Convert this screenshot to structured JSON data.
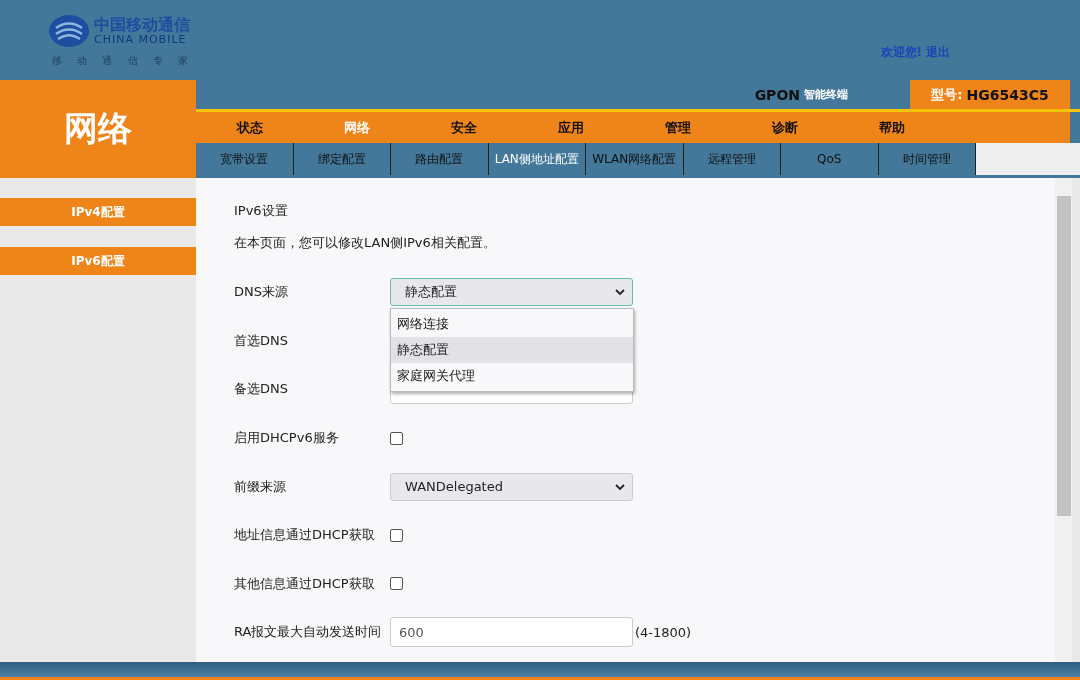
{
  "header": {
    "logo": {
      "cn": "中国移动通信",
      "en": "CHINA MOBILE",
      "slogan": "移 动 通 信 专 家"
    },
    "welcome": "欢迎您!",
    "logout": "退出"
  },
  "section_title": "网络",
  "product": {
    "type": "GPON",
    "type_suffix": "智能终端",
    "model_label": "型号:",
    "model": "HG6543C5"
  },
  "main_menu": [
    {
      "label": "状态",
      "selected": false
    },
    {
      "label": "网络",
      "selected": true
    },
    {
      "label": "安全",
      "selected": false
    },
    {
      "label": "应用",
      "selected": false
    },
    {
      "label": "管理",
      "selected": false
    },
    {
      "label": "诊断",
      "selected": false
    },
    {
      "label": "帮助",
      "selected": false
    }
  ],
  "sub_menu": [
    {
      "label": "宽带设置",
      "selected": false
    },
    {
      "label": "绑定配置",
      "selected": false
    },
    {
      "label": "路由配置",
      "selected": false
    },
    {
      "label": "LAN侧地址配置",
      "selected": true
    },
    {
      "label": "WLAN网络配置",
      "selected": false
    },
    {
      "label": "远程管理",
      "selected": false
    },
    {
      "label": "QoS",
      "selected": false
    },
    {
      "label": "时间管理",
      "selected": false
    }
  ],
  "sidebar": {
    "items": [
      {
        "label": "IPv4配置"
      },
      {
        "label": "IPv6配置"
      }
    ]
  },
  "content": {
    "title": "IPv6设置",
    "description": "在本页面，您可以修改LAN侧IPv6相关配置。",
    "fields": [
      {
        "kind": "select",
        "label": "DNS来源",
        "value": "静态配置",
        "expanded": true,
        "options": [
          {
            "label": "网络连接",
            "selected": false
          },
          {
            "label": "静态配置",
            "selected": true
          },
          {
            "label": "家庭网关代理",
            "selected": false
          }
        ]
      },
      {
        "kind": "text",
        "label": "首选DNS"
      },
      {
        "kind": "text",
        "label": "备选DNS"
      },
      {
        "kind": "checkbox",
        "label": "启用DHCPv6服务",
        "checked": false
      },
      {
        "kind": "select",
        "label": "前缀来源",
        "value": "WANDelegated",
        "expanded": false
      },
      {
        "kind": "checkbox",
        "label": "地址信息通过DHCP获取",
        "checked": false
      },
      {
        "kind": "checkbox",
        "label": "其他信息通过DHCP获取",
        "checked": false
      },
      {
        "kind": "text",
        "label": "RA报文最大自动发送时间",
        "value": "600",
        "suffix": "(4-1800)"
      }
    ]
  }
}
